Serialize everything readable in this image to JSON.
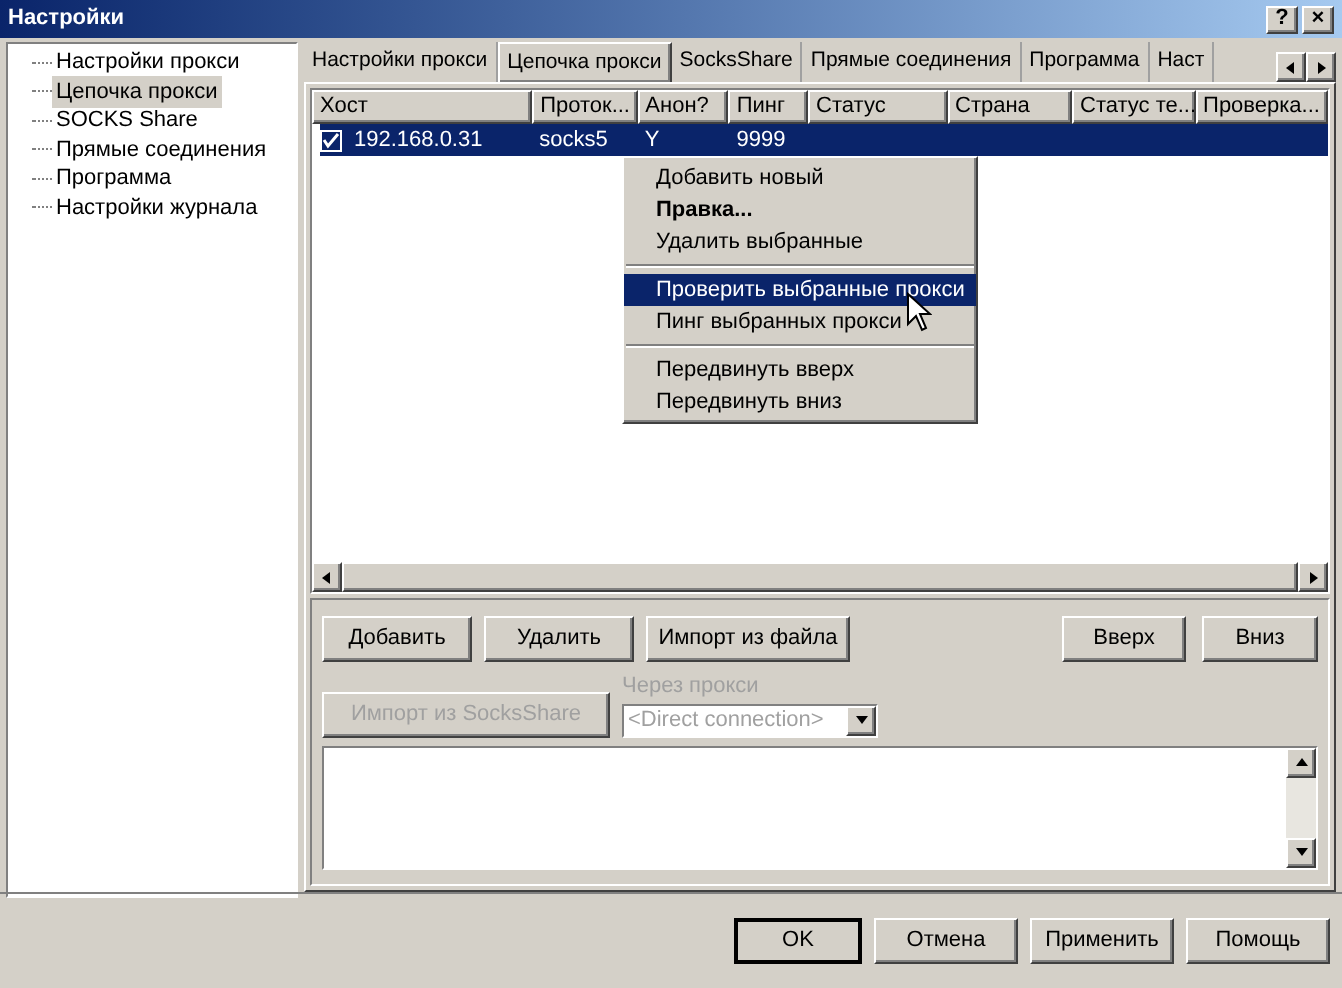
{
  "window": {
    "title": "Настройки",
    "title_buttons": [
      "?",
      "×"
    ]
  },
  "tree": [
    {
      "label": "Настройки прокси",
      "selected": false
    },
    {
      "label": "Цепочка прокси",
      "selected": true
    },
    {
      "label": "SOCKS Share",
      "selected": false
    },
    {
      "label": "Прямые соединения",
      "selected": false
    },
    {
      "label": "Программа",
      "selected": false
    },
    {
      "label": "Настройки журнала",
      "selected": false
    }
  ],
  "tabs": [
    {
      "label": "Настройки прокси",
      "selected": false
    },
    {
      "label": "Цепочка прокси",
      "selected": true
    },
    {
      "label": "SocksShare",
      "selected": false
    },
    {
      "label": "Прямые соединения",
      "selected": false
    },
    {
      "label": "Программа",
      "selected": false
    },
    {
      "label": "Наст",
      "selected": false
    }
  ],
  "table": {
    "columns": [
      "Хост",
      "Проток...",
      "Анон?",
      "Пинг",
      "Статус",
      "Страна",
      "Статус те...",
      "Проверка..."
    ],
    "rows": [
      {
        "checked": true,
        "selected": true,
        "cells": [
          "192.168.0.31",
          "socks5",
          "Y",
          "9999",
          "",
          "",
          "",
          ""
        ]
      }
    ]
  },
  "context_menu": [
    {
      "kind": "item",
      "label": "Добавить новый",
      "bold": false,
      "selected": false
    },
    {
      "kind": "item",
      "label": "Правка...",
      "bold": true,
      "selected": false
    },
    {
      "kind": "item",
      "label": "Удалить выбранные",
      "bold": false,
      "selected": false
    },
    {
      "kind": "separator"
    },
    {
      "kind": "item",
      "label": "Проверить выбранные прокси",
      "bold": false,
      "selected": true
    },
    {
      "kind": "item",
      "label": "Пинг выбранных прокси",
      "bold": false,
      "selected": false
    },
    {
      "kind": "separator"
    },
    {
      "kind": "item",
      "label": "Передвинуть вверх",
      "bold": false,
      "selected": false
    },
    {
      "kind": "item",
      "label": "Передвинуть вниз",
      "bold": false,
      "selected": false
    }
  ],
  "actions_left": [
    "Добавить",
    "Удалить",
    "Импорт из файла"
  ],
  "actions_right": [
    "Вверх",
    "Вниз"
  ],
  "import_button": {
    "label": "Импорт из SocksShare",
    "disabled": true
  },
  "via_proxy": {
    "label": "Через прокси",
    "value": "<Direct connection>",
    "disabled": true
  },
  "footer_buttons": [
    {
      "label": "OK",
      "default": true
    },
    {
      "label": "Отмена",
      "default": false
    },
    {
      "label": "Применить",
      "default": false
    },
    {
      "label": "Помощь",
      "default": false
    }
  ]
}
